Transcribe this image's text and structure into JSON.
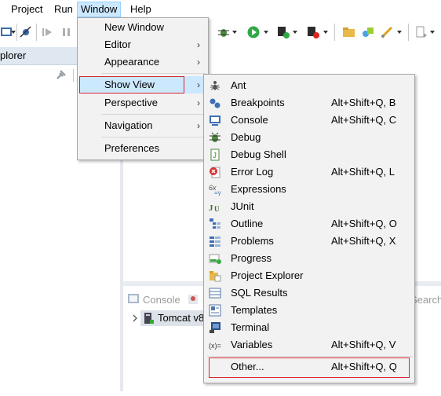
{
  "menubar": {
    "items": [
      "Project",
      "Run",
      "Window",
      "Help"
    ],
    "active": "Window"
  },
  "left_panel": {
    "title": "plorer"
  },
  "window_menu": {
    "items": [
      {
        "label": "New Window",
        "submenu": false
      },
      {
        "label": "Editor",
        "submenu": true
      },
      {
        "label": "Appearance",
        "submenu": true
      },
      {
        "label": "Show View",
        "submenu": true,
        "selected": true
      },
      {
        "label": "Perspective",
        "submenu": true
      },
      {
        "label": "Navigation",
        "submenu": true
      },
      {
        "label": "Preferences",
        "submenu": false
      }
    ]
  },
  "show_view_menu": {
    "items": [
      {
        "label": "Ant",
        "shortcut": "",
        "icon": "ant-icon"
      },
      {
        "label": "Breakpoints",
        "shortcut": "Alt+Shift+Q, B",
        "icon": "breakpoints-icon"
      },
      {
        "label": "Console",
        "shortcut": "Alt+Shift+Q, C",
        "icon": "console-icon"
      },
      {
        "label": "Debug",
        "shortcut": "",
        "icon": "debug-icon"
      },
      {
        "label": "Debug Shell",
        "shortcut": "",
        "icon": "debug-shell-icon"
      },
      {
        "label": "Error Log",
        "shortcut": "Alt+Shift+Q, L",
        "icon": "error-log-icon"
      },
      {
        "label": "Expressions",
        "shortcut": "",
        "icon": "expressions-icon"
      },
      {
        "label": "JUnit",
        "shortcut": "",
        "icon": "junit-icon"
      },
      {
        "label": "Outline",
        "shortcut": "Alt+Shift+Q, O",
        "icon": "outline-icon"
      },
      {
        "label": "Problems",
        "shortcut": "Alt+Shift+Q, X",
        "icon": "problems-icon"
      },
      {
        "label": "Progress",
        "shortcut": "",
        "icon": "progress-icon"
      },
      {
        "label": "Project Explorer",
        "shortcut": "",
        "icon": "project-explorer-icon"
      },
      {
        "label": "SQL Results",
        "shortcut": "",
        "icon": "sql-results-icon"
      },
      {
        "label": "Templates",
        "shortcut": "",
        "icon": "templates-icon"
      },
      {
        "label": "Terminal",
        "shortcut": "",
        "icon": "terminal-icon"
      },
      {
        "label": "Variables",
        "shortcut": "Alt+Shift+Q, V",
        "icon": "variables-icon"
      }
    ],
    "other": {
      "label": "Other...",
      "shortcut": "Alt+Shift+Q, Q"
    }
  },
  "console_panel": {
    "tab": "Console",
    "server": "Tomcat v8",
    "search_hint": "Search"
  },
  "colors": {
    "highlight_border": "#d9242f",
    "menu_background": "#f2f2f2",
    "selection_background": "#cce8ff"
  }
}
